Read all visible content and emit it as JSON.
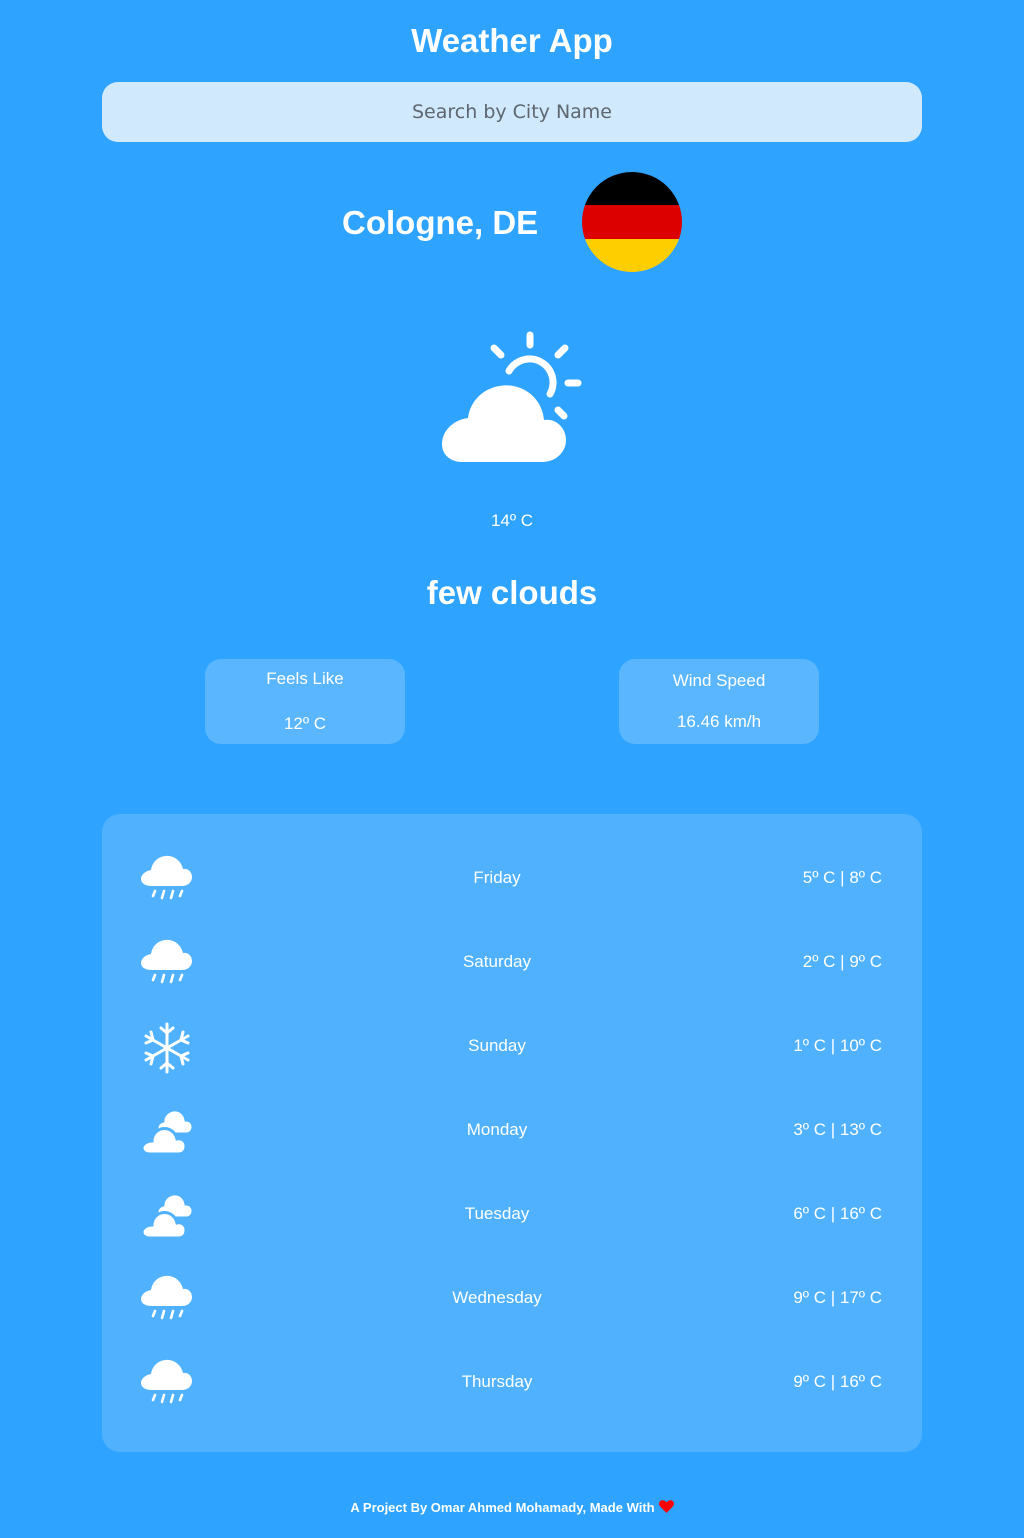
{
  "header": {
    "title": "Weather App"
  },
  "search": {
    "placeholder": "Search by City Name",
    "value": ""
  },
  "location": {
    "city": "Cologne, DE",
    "flag_icon": "flag-germany-icon",
    "flag_colors": [
      "#000000",
      "#dd0000",
      "#ffce00"
    ]
  },
  "current": {
    "icon": "partly-cloudy-day-icon",
    "temperature": "14º C",
    "description": "few clouds",
    "feels_like": {
      "label": "Feels Like",
      "value": "12º C"
    },
    "wind_speed": {
      "label": "Wind Speed",
      "value": "16.46 km/h"
    }
  },
  "forecast": [
    {
      "day": "Friday",
      "temps": "5º C | 8º C",
      "icon": "rain-icon"
    },
    {
      "day": "Saturday",
      "temps": "2º C | 9º C",
      "icon": "rain-icon"
    },
    {
      "day": "Sunday",
      "temps": "1º C | 10º C",
      "icon": "snow-icon"
    },
    {
      "day": "Monday",
      "temps": "3º C | 13º C",
      "icon": "cloudy-icon"
    },
    {
      "day": "Tuesday",
      "temps": "6º C | 16º C",
      "icon": "cloudy-icon"
    },
    {
      "day": "Wednesday",
      "temps": "9º C | 17º C",
      "icon": "rain-icon"
    },
    {
      "day": "Thursday",
      "temps": "9º C | 16º C",
      "icon": "rain-icon"
    }
  ],
  "footer": {
    "text": "A Project By Omar Ahmed Mohamady, Made With",
    "icon": "heart-icon"
  },
  "colors": {
    "background": "#2ea3ff",
    "search_bg": "#d0e9fd",
    "card_bg": "#5ab6ff",
    "forecast_bg": "#50b2fe",
    "heart": "#ff0000"
  }
}
